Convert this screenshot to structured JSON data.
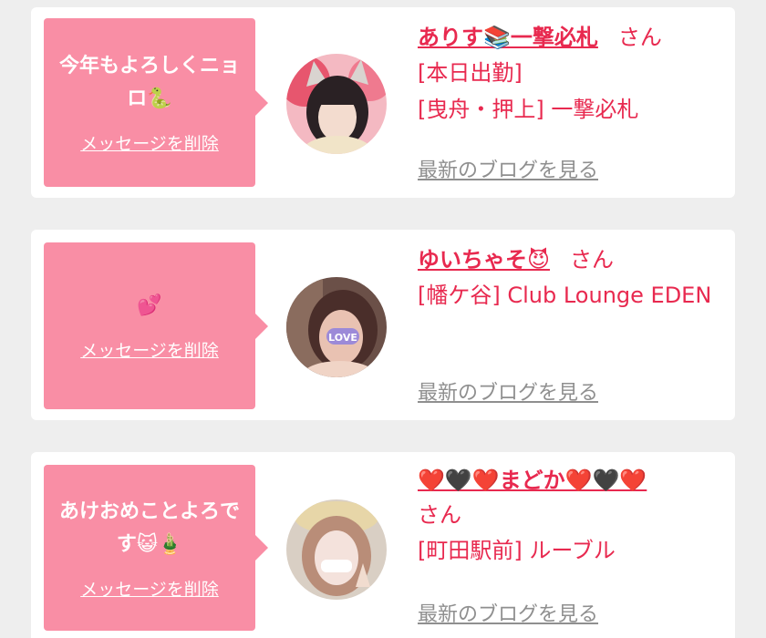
{
  "entries": [
    {
      "message": "今年もよろしくニョロ🐍",
      "delete_label": "メッセージを削除",
      "girl_name": "ありす📚一撃必札",
      "honorific": "さん",
      "status": "[本日出勤]",
      "shop": "[曳舟・押上] 一撃必札",
      "blog_label": "最新のブログを見る",
      "avatar_icon": "profile-photo"
    },
    {
      "message": "💕",
      "delete_label": "メッセージを削除",
      "girl_name": "ゆいちゃそ😈",
      "honorific": "さん",
      "status": "",
      "shop": "[幡ケ谷] Club Lounge EDEN",
      "blog_label": "最新のブログを見る",
      "avatar_icon": "profile-photo"
    },
    {
      "message": "あけおめことよろです😺🎍",
      "delete_label": "メッセージを削除",
      "girl_name": "❤️🖤❤️まどか❤️🖤❤️",
      "honorific": "さん",
      "status": "",
      "shop": "[町田駅前] ルーブル",
      "blog_label": "最新のブログを見る",
      "avatar_icon": "profile-photo"
    }
  ],
  "colors": {
    "bubble": "#f98ea5",
    "accent": "#e8294f",
    "link_gray": "#8f8f8f",
    "background": "#eeeeee"
  }
}
